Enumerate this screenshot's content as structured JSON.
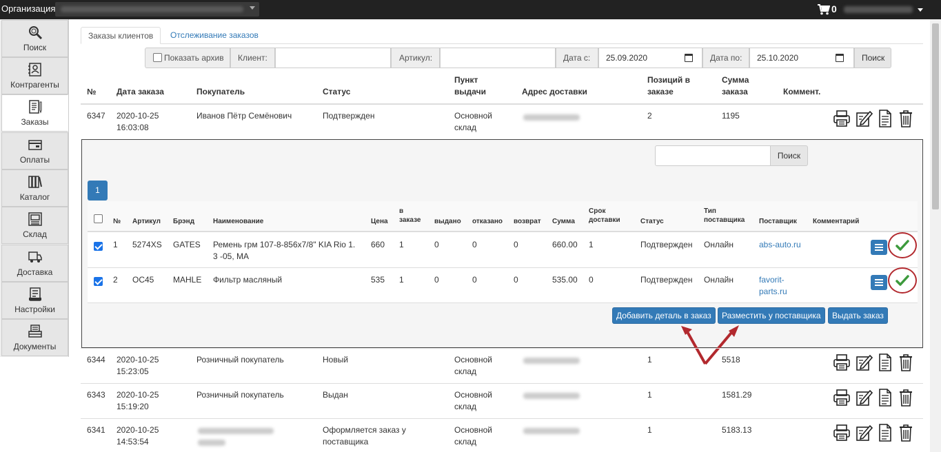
{
  "topbar": {
    "org_label": "Организация:",
    "cart_count": "0"
  },
  "sidebar": {
    "items": [
      {
        "label": "Поиск",
        "icon": "search-icon"
      },
      {
        "label": "Контрагенты",
        "icon": "contacts-icon"
      },
      {
        "label": "Заказы",
        "icon": "orders-icon",
        "active": true
      },
      {
        "label": "Оплаты",
        "icon": "payments-icon"
      },
      {
        "label": "Каталог",
        "icon": "catalog-icon"
      },
      {
        "label": "Склад",
        "icon": "warehouse-icon"
      },
      {
        "label": "Доставка",
        "icon": "delivery-icon"
      },
      {
        "label": "Настройки",
        "icon": "settings-icon"
      },
      {
        "label": "Документы",
        "icon": "documents-icon"
      }
    ]
  },
  "tabs": {
    "active": "Заказы клиентов",
    "other": "Отслеживание заказов"
  },
  "filters": {
    "archive_label": "Показать архив",
    "client_label": "Клиент:",
    "article_label": "Артикул:",
    "date_from_label": "Дата с:",
    "date_from": "25.09.2020",
    "date_to_label": "Дата по:",
    "date_to": "25.10.2020",
    "search_button": "Поиск"
  },
  "orders_table": {
    "headers": {
      "num": "№",
      "date": "Дата заказа",
      "buyer": "Покупатель",
      "status": "Статус",
      "pickup_1": "Пункт",
      "pickup_2": "выдачи",
      "address": "Адрес доставки",
      "positions_1": "Позиций в",
      "positions_2": "заказе",
      "sum_1": "Сумма",
      "sum_2": "заказа",
      "comment": "Коммент."
    },
    "rows": [
      {
        "num": "6347",
        "date": "2020-10-25",
        "time": "16:03:08",
        "buyer": "Иванов Пётр Семёнович",
        "status": "Подтвержден",
        "pickup_1": "Основной",
        "pickup_2": "склад",
        "positions": "2",
        "sum": "1195"
      },
      {
        "num": "6344",
        "date": "2020-10-25",
        "time": "15:23:05",
        "buyer": "Розничный покупатель",
        "status": "Новый",
        "pickup_1": "Основной",
        "pickup_2": "склад",
        "positions": "1",
        "sum": "5518"
      },
      {
        "num": "6343",
        "date": "2020-10-25",
        "time": "15:19:20",
        "buyer": "Розничный покупатель",
        "status": "Выдан",
        "pickup_1": "Основной",
        "pickup_2": "склад",
        "positions": "1",
        "sum": "1581.29"
      },
      {
        "num": "6341",
        "date": "2020-10-25",
        "time": "14:53:54",
        "buyer": "",
        "status_1": "Оформляется заказ у",
        "status_2": "поставщика",
        "pickup_1": "Основной",
        "pickup_2": "склад",
        "positions": "1",
        "sum": "5183.13"
      }
    ]
  },
  "details": {
    "search_button": "Поиск",
    "page": "1",
    "headers": {
      "num": "№",
      "article": "Артикул",
      "brand": "Брэнд",
      "name": "Наименование",
      "price": "Цена",
      "in_order_1": "в",
      "in_order_2": "заказе",
      "issued": "выдано",
      "refused": "отказано",
      "returned": "возврат",
      "sum": "Сумма",
      "term_1": "Срок",
      "term_2": "доставки",
      "status": "Статус",
      "supplier_type_1": "Тип",
      "supplier_type_2": "поставщика",
      "supplier": "Поставщик",
      "comment": "Комментарий"
    },
    "rows": [
      {
        "num": "1",
        "article": "5274XS",
        "brand": "GATES",
        "name_1": "Ремень грм 107-8-856x7/8\" KIA Rio 1.",
        "name_2": "3 -05, МА",
        "price": "660",
        "in_order": "1",
        "issued": "0",
        "refused": "0",
        "returned": "0",
        "sum": "660.00",
        "term": "1",
        "status": "Подтвержден",
        "supplier_type": "Онлайн",
        "supplier_1": "abs-auto.ru",
        "supplier_2": ""
      },
      {
        "num": "2",
        "article": "OC45",
        "brand": "MAHLE",
        "name_1": "Фильтр масляный",
        "name_2": "",
        "price": "535",
        "in_order": "1",
        "issued": "0",
        "refused": "0",
        "returned": "0",
        "sum": "535.00",
        "term": "0",
        "status": "Подтвержден",
        "supplier_type": "Онлайн",
        "supplier_1": "favorit-",
        "supplier_2": "parts.ru"
      }
    ],
    "buttons": {
      "add_detail": "Добавить деталь в заказ",
      "place_supplier": "Разместить у поставщика",
      "issue_order": "Выдать заказ"
    }
  },
  "colors": {
    "accent": "#337ab7",
    "annotation": "#b2292e",
    "ok": "#3c9a3c"
  }
}
